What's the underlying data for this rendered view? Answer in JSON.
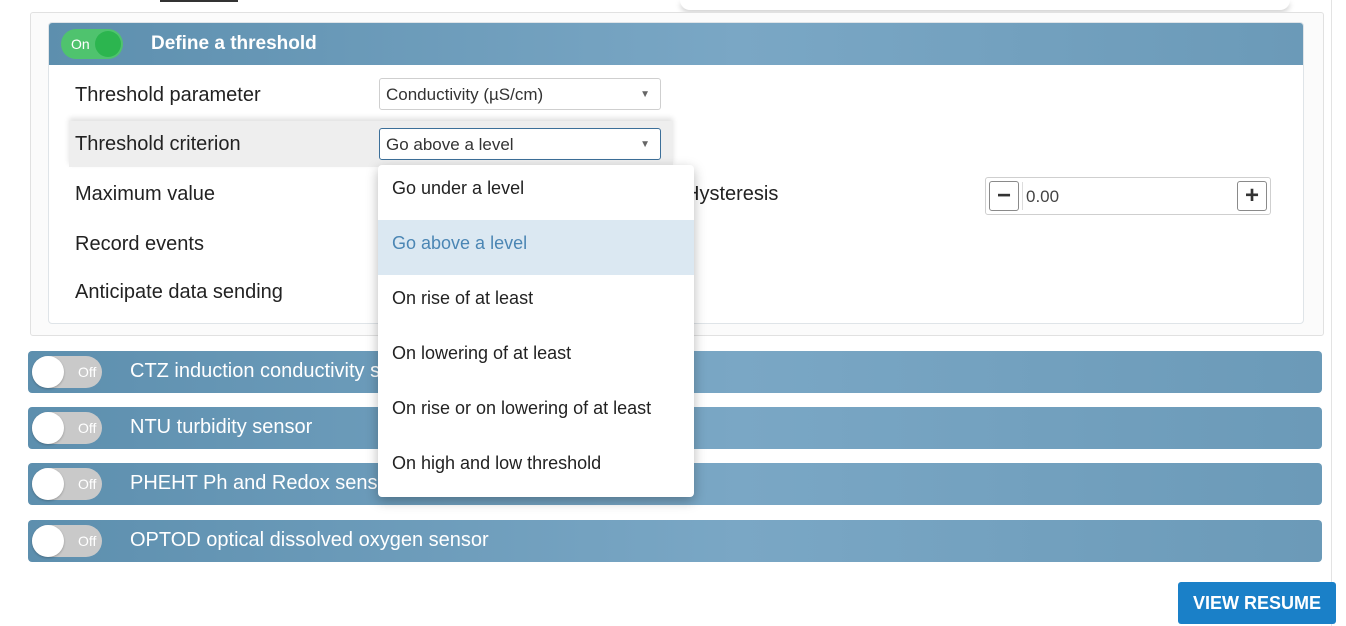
{
  "threshold_section": {
    "toggle_label": "On",
    "title": "Define a threshold",
    "rows": {
      "parameter_label": "Threshold parameter",
      "parameter_value": "Conductivity (µS/cm)",
      "criterion_label": "Threshold criterion",
      "criterion_value": "Go above a level",
      "max_value_label": "Maximum value",
      "record_events_label": "Record events",
      "anticipate_label": "Anticipate data sending"
    },
    "hysteresis": {
      "label": "Hysteresis",
      "value": "0.00"
    }
  },
  "dropdown": {
    "options": [
      "Go under a level",
      "Go above a level",
      "On rise of at least",
      "On lowering of at least",
      "On rise or on lowering of at least",
      "On high and low threshold"
    ],
    "selected_index": 1
  },
  "sensors": [
    {
      "toggle_label": "Off",
      "title": "CTZ induction conductivity sensor"
    },
    {
      "toggle_label": "Off",
      "title": "NTU turbidity sensor"
    },
    {
      "toggle_label": "Off",
      "title": "PHEHT Ph and Redox sensor"
    },
    {
      "toggle_label": "Off",
      "title": "OPTOD optical dissolved oxygen sensor"
    }
  ],
  "actions": {
    "view_resume_label": "VIEW RESUME"
  },
  "colors": {
    "header_blue": "#6b9ab8",
    "toggle_on": "#4fc36e",
    "toggle_off": "#c9c9c9",
    "button_blue": "#1a80c8",
    "selected_option_bg": "#dbe8f2"
  }
}
